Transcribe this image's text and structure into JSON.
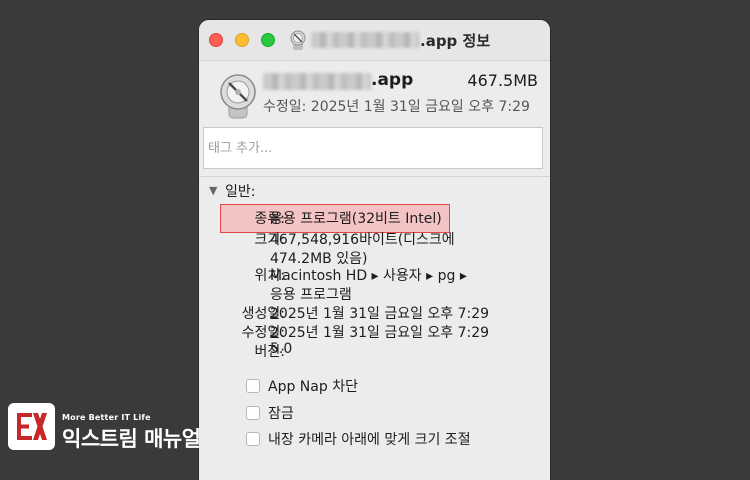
{
  "window": {
    "title_suffix": ".app 정보"
  },
  "header": {
    "name_suffix": ".app",
    "size": "467.5MB",
    "modified": "수정일: 2025년 1월 31일 금요일 오후 7:29"
  },
  "tags": {
    "placeholder": "태그 추가..."
  },
  "general": {
    "toggle_icon": "chevron-down-icon",
    "title": "일반:",
    "rows": [
      {
        "label": "종류:",
        "value": "응용 프로그램(32비트 Intel)"
      },
      {
        "label": "크기:",
        "value": "467,548,916바이트(디스크에",
        "value2": "474.2MB 있음)"
      },
      {
        "label": "위치:",
        "value": "Macintosh HD ▸ 사용자 ▸ pg ▸",
        "value2": "응용 프로그램"
      },
      {
        "label": "생성일:",
        "value": "2025년 1월 31일 금요일 오후 7:29"
      },
      {
        "label": "수정일:",
        "value": "2025년 1월 31일 금요일 오후 7:29"
      },
      {
        "label": "버전:",
        "value": "5.0"
      }
    ],
    "checkboxes": [
      {
        "label": "App Nap 차단",
        "checked": false
      },
      {
        "label": "잠금",
        "checked": false
      },
      {
        "label": "내장 카메라 아래에 맞게 크기 조절",
        "checked": false
      }
    ]
  },
  "watermark": {
    "tagline": "More Better IT Life",
    "name": "익스트림 매뉴얼"
  },
  "colors": {
    "highlight_fill": "#f4c4c4",
    "highlight_border": "#e04848",
    "close": "#ff5f57",
    "minimize": "#febc2e",
    "zoom": "#28c840"
  }
}
